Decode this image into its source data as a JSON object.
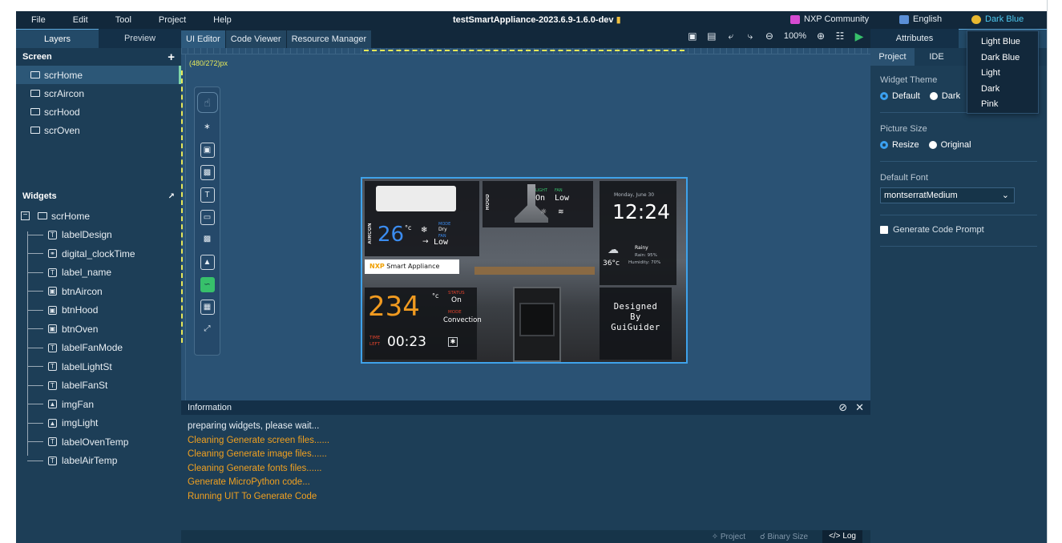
{
  "menu": {
    "items": [
      "File",
      "Edit",
      "Tool",
      "Project",
      "Help"
    ],
    "project_title": "testSmartAppliance-2023.6.9-1.6.0-dev",
    "community": "NXP Community",
    "language": "English",
    "theme": "Dark Blue"
  },
  "left_panel": {
    "tabs": [
      "Layers",
      "Preview"
    ],
    "screen_header": "Screen",
    "screens": [
      "scrHome",
      "scrAircon",
      "scrHood",
      "scrOven"
    ],
    "widgets_header": "Widgets",
    "tree_root": "scrHome",
    "tree_children": [
      {
        "label": "labelDesign",
        "icon": "label-icon"
      },
      {
        "label": "digital_clockTime",
        "icon": "clock-icon"
      },
      {
        "label": "label_name",
        "icon": "label-icon"
      },
      {
        "label": "btnAircon",
        "icon": "button-icon"
      },
      {
        "label": "btnHood",
        "icon": "button-icon"
      },
      {
        "label": "btnOven",
        "icon": "button-icon"
      },
      {
        "label": "labelFanMode",
        "icon": "label-icon"
      },
      {
        "label": "labelLightSt",
        "icon": "label-icon"
      },
      {
        "label": "labelFanSt",
        "icon": "label-icon"
      },
      {
        "label": "imgFan",
        "icon": "image-icon"
      },
      {
        "label": "imgLight",
        "icon": "image-icon"
      },
      {
        "label": "labelOvenTemp",
        "icon": "label-icon"
      },
      {
        "label": "labelAirTemp",
        "icon": "label-icon"
      }
    ]
  },
  "editor": {
    "tabs": [
      "UI Editor",
      "Code Viewer",
      "Resource Manager"
    ],
    "zoom": "100%",
    "canvas_size": "(480/272)px"
  },
  "preview": {
    "ac_label": "AIRCON",
    "ac_temp": "26",
    "ac_unit": "°c",
    "ac_mode_label": "MODE",
    "ac_mode_value": "Dry",
    "ac_fan_label": "FAN",
    "ac_fan_value": "Low",
    "hood_label": "HOOD",
    "hood_light_label": "LIGHT",
    "hood_fan_label": "FAN",
    "hood_light_value": "On",
    "hood_fan_value": "Low",
    "date": "Monday, June 30",
    "time": "12:24",
    "weather": "Rainy",
    "rain": "Rain: 95%",
    "humidity": "Humidity: 70%",
    "outdoor_temp": "36°c",
    "brand": "Smart Appliance",
    "brand_logo": "NXP",
    "oven_temp": "234",
    "oven_unit": "°c",
    "oven_status_label": "STATUS",
    "oven_status_value": "On",
    "oven_mode_label": "MODE",
    "oven_mode_value": "Convection",
    "time_left_label_1": "TIME",
    "time_left_label_2": "LEFT",
    "time_left": "00:23",
    "design_line1": "Designed",
    "design_line2": "By",
    "design_line3": "GuiGuider"
  },
  "info": {
    "title": "Information",
    "lines": [
      "preparing widgets, please wait...",
      "Cleaning Generate screen files......",
      "Cleaning Generate image files......",
      "Cleaning Generate fonts files......",
      "Generate MicroPython code...",
      "Running UIT To Generate Code"
    ],
    "status_items": [
      "Project",
      "Binary Size",
      "Log"
    ]
  },
  "right_panel": {
    "tabs": [
      "Attributes",
      "IDE"
    ],
    "subtabs": [
      "Project",
      "IDE"
    ],
    "widget_theme_label": "Widget Theme",
    "widget_theme_options": [
      "Default",
      "Dark"
    ],
    "picture_size_label": "Picture Size",
    "picture_size_options": [
      "Resize",
      "Original"
    ],
    "default_font_label": "Default Font",
    "default_font_value": "montserratMedium",
    "generate_prompt_label": "Generate Code Prompt"
  },
  "theme_menu": {
    "options": [
      "Light Blue",
      "Dark Blue",
      "Light",
      "Dark",
      "Pink"
    ]
  },
  "colors": {
    "accent_green": "#37c06b",
    "log_orange": "#f0a020",
    "selection_blue": "#3fa2ea"
  }
}
